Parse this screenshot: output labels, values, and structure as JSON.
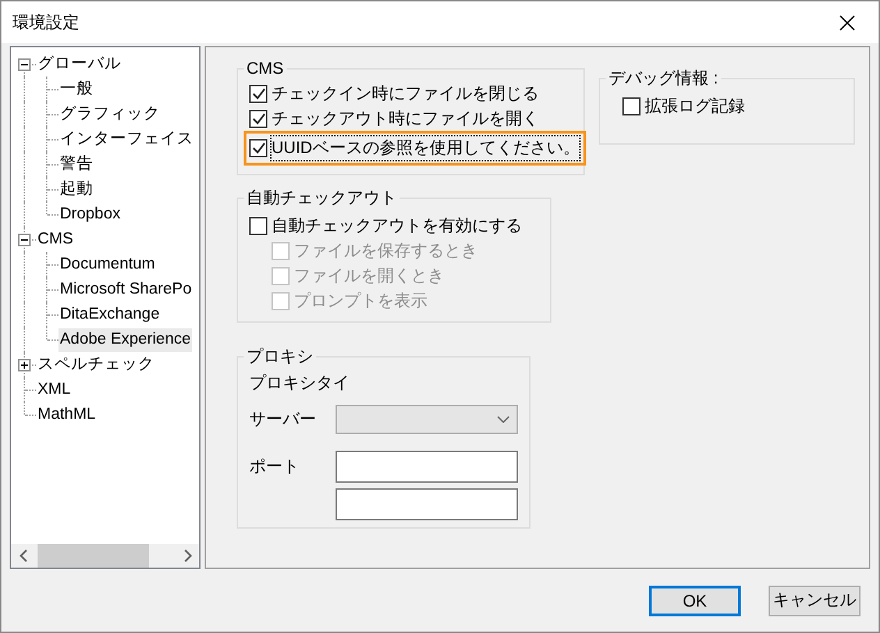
{
  "window": {
    "title": "環境設定"
  },
  "tree": [
    {
      "label": "グローバル",
      "expanded": true,
      "selected": false,
      "children": [
        {
          "label": "一般",
          "selected": false
        },
        {
          "label": "グラフィック",
          "selected": false
        },
        {
          "label": "インターフェイス",
          "selected": false
        },
        {
          "label": "警告",
          "selected": false
        },
        {
          "label": "起動",
          "selected": false
        },
        {
          "label": "Dropbox",
          "selected": false
        }
      ]
    },
    {
      "label": "CMS",
      "expanded": true,
      "selected": false,
      "children": [
        {
          "label": "Documentum",
          "selected": false
        },
        {
          "label": "Microsoft SharePo",
          "selected": false
        },
        {
          "label": "DitaExchange",
          "selected": false
        },
        {
          "label": "Adobe Experience",
          "selected": true
        }
      ]
    },
    {
      "label": "スペルチェック",
      "expanded": false,
      "selected": false
    },
    {
      "label": "XML",
      "selected": false
    },
    {
      "label": "MathML",
      "selected": false
    }
  ],
  "cms_group": {
    "title": "CMS",
    "options": [
      {
        "label": "チェックイン時にファイルを閉じる",
        "checked": true,
        "highlighted": false
      },
      {
        "label": "チェックアウト時にファイルを開く",
        "checked": true,
        "highlighted": false
      },
      {
        "label": "UUIDベースの参照を使用してください。",
        "checked": true,
        "highlighted": true
      }
    ]
  },
  "auto_checkout": {
    "title": "自動チェックアウト",
    "enable": {
      "label": "自動チェックアウトを有効にする",
      "checked": false
    },
    "options": [
      {
        "label": "ファイルを保存するとき",
        "checked": false,
        "disabled": true
      },
      {
        "label": "ファイルを開くとき",
        "checked": false,
        "disabled": true
      },
      {
        "label": "プロンプトを表示",
        "checked": false,
        "disabled": true
      }
    ]
  },
  "proxy": {
    "title": "プロキシ",
    "type_label": "プロキシタイ",
    "server": {
      "label": "サーバー",
      "disabled": true
    },
    "port": {
      "label": "ポート"
    }
  },
  "debug": {
    "title": "デバッグ情報 :",
    "options": [
      {
        "label": "拡張ログ記録",
        "checked": false
      }
    ]
  },
  "buttons": [
    {
      "label": "OK",
      "default": true
    },
    {
      "label": "キャンセル",
      "default": false
    }
  ]
}
